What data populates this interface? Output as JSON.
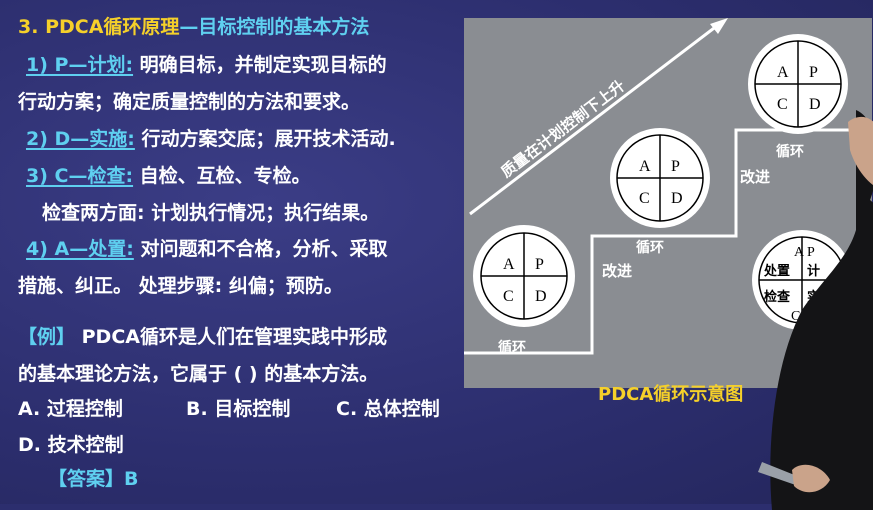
{
  "slide": {
    "heading_num": "3. ",
    "heading_main": "PDCA循环原理",
    "heading_sub": "—目标控制的基本方法",
    "p1_label": "1) P—计划:",
    "p1_text": " 明确目标，并制定实现目标的",
    "p1_text2": "行动方案；确定质量控制的方法和要求。",
    "p2_label": "2) D—实施:",
    "p2_text": " 行动方案交底；展开技术活动.",
    "p3_label": "3) C—检查:",
    "p3_text": "   自检、互检、专检。",
    "p3_text2": "检查两方面: 计划执行情况；执行结果。",
    "p4_label": "4) A—处置:",
    "p4_text": " 对问题和不合格，分析、采取",
    "p4_text2": "措施、纠正。 处理步骤: 纠偏；预防。",
    "ex_label": "【例】",
    "ex_text": " PDCA循环是人们在管理实践中形成",
    "ex_text2": "的基本理论方法，它属于 (      ) 的基本方法。",
    "opt_a": "A. 过程控制",
    "opt_b": "B. 目标控制",
    "opt_c": "C. 总体控制",
    "opt_d": "D. 技术控制",
    "ans_label": "【答案】",
    "ans_value": "B"
  },
  "diagram": {
    "arrow_label": "质量在计划控制下上升",
    "cycle_label": "循环",
    "improve_label": "改进",
    "quadrants": [
      "A",
      "P",
      "C",
      "D"
    ],
    "partial_quadrants": [
      "处置",
      "计",
      "检查",
      "实",
      "C"
    ],
    "caption": "PDCA循环示意图"
  },
  "colors": {
    "background": "#2c2e6e",
    "heading": "#f5d02a",
    "label": "#5fd0f0",
    "text": "#ffffff",
    "diagram_bg": "#8a8d92"
  }
}
